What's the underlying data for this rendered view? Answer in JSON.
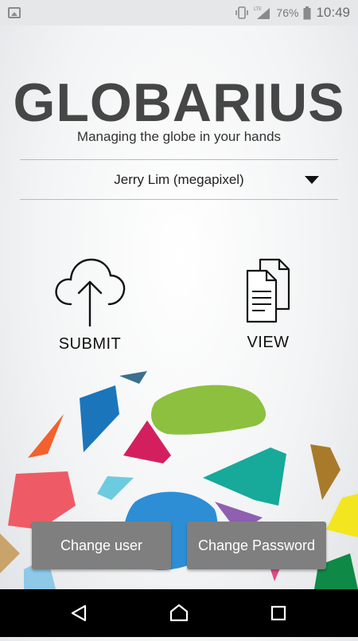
{
  "status_bar": {
    "battery_percent": "76%",
    "time": "10:49",
    "network": "LTE"
  },
  "app": {
    "title": "GLOBARIUS",
    "subtitle": "Managing the globe in your hands"
  },
  "user_selector": {
    "selected": "Jerry Lim (megapixel)"
  },
  "actions": {
    "submit_label": "SUBMIT",
    "view_label": "VIEW"
  },
  "buttons": {
    "change_user": "Change user",
    "change_password": "Change Password"
  },
  "icons": {
    "submit": "cloud-upload-icon",
    "view": "documents-icon",
    "back": "back-triangle-icon",
    "home": "home-icon",
    "recents": "recents-square-icon"
  },
  "colors": {
    "title": "#464646",
    "button_bg": "#7f7f7f",
    "navbar": "#000000"
  }
}
